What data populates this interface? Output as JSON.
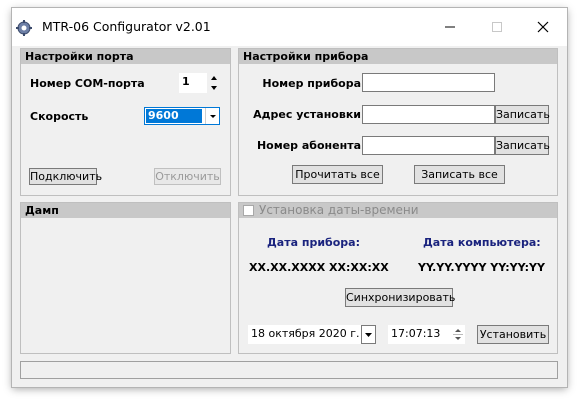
{
  "window": {
    "title": "MTR-06 Configurator v2.01"
  },
  "port_panel": {
    "header": "Настройки порта",
    "com_label": "Номер COM-порта",
    "com_value": "1",
    "speed_label": "Скорость",
    "speed_value": "9600",
    "connect_label": "Подключить",
    "disconnect_label": "Отключить"
  },
  "device_panel": {
    "header": "Настройки прибора",
    "number_label": "Номер прибора",
    "number_value": "",
    "address_label": "Адрес установки",
    "address_value": "",
    "address_write_label": "Записать",
    "subscriber_label": "Номер абонента",
    "subscriber_value": "",
    "subscriber_write_label": "Записать",
    "read_all_label": "Прочитать все",
    "write_all_label": "Записать все"
  },
  "dump_panel": {
    "header": "Дамп"
  },
  "datetime_panel": {
    "header": "Установка даты-времени",
    "device_date_label": "Дата прибора:",
    "device_date_value": "XX.XX.XXXX XX:XX:XX",
    "pc_date_label": "Дата компьютера:",
    "pc_date_value": "YY.YY.YYYY YY:YY:YY",
    "sync_label": "Синхронизировать",
    "date_value": "18  октября  2020 г.",
    "time_value": "17:07:13",
    "set_label": "Установить"
  },
  "status_bar": {
    "text": ""
  },
  "colors": {
    "selection": "#0078d7",
    "panel_header": "#c8c8c8",
    "label_blue": "#1a237e"
  },
  "icons": [
    "app-gear-icon",
    "minimize-icon",
    "maximize-icon",
    "close-icon",
    "spin-up-icon",
    "spin-down-icon",
    "chevron-down-icon",
    "checkbox-icon"
  ]
}
